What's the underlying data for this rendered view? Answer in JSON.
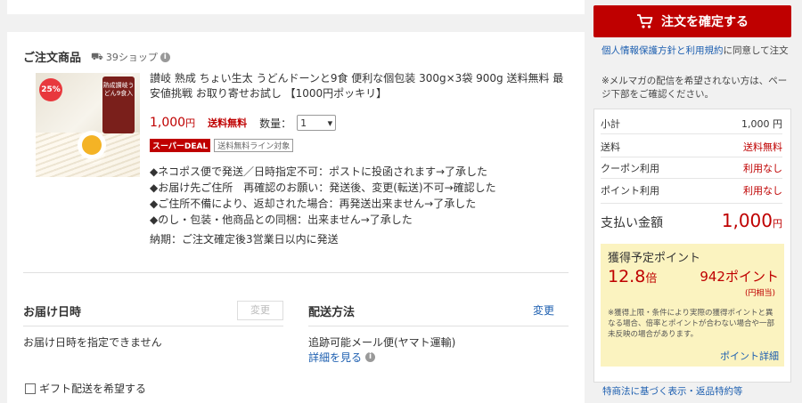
{
  "order": {
    "section_title": "ご注文商品",
    "shop_name": "39ショップ",
    "product_title": "讃岐 熟成 ちょい生太 うどんドーンと9食 便利な個包装 300g×3袋 900g 送料無料 最安値挑戦 お取り寄せお試し 【1000円ポッキリ】",
    "thumb_badge": "25%",
    "thumb_pack_text": "熟成讃岐うどん9食入",
    "price_value": "1,000",
    "price_unit": "円",
    "shipping_free": "送料無料",
    "qty_label": "数量：",
    "qty_value": "1",
    "tag_deal": "スーパーDEAL",
    "tag_free_line": "送料無料ライン対象",
    "notes": [
      "◆ネコポス便で発送／日時指定不可：ポストに投函されます→了承した",
      "◆お届け先ご住所　再確認のお願い：発送後、変更(転送)不可→確認した",
      "◆ご住所不備により、返却された場合：再発送出来ません→了承した",
      "◆のし・包装・他商品との同梱：出来ません→了承した"
    ],
    "delivery_info": "納期：ご注文確定後3営業日以内に発送"
  },
  "delivery": {
    "date_title": "お届け日時",
    "date_change": "変更",
    "date_text": "お届け日時を指定できません",
    "method_title": "配送方法",
    "method_change": "変更",
    "method_text": "追跡可能メール便(ヤマト運輸)",
    "method_detail": "詳細を見る",
    "gift_label": "ギフト配送を希望する"
  },
  "sidebar": {
    "confirm_label": "注文を確定する",
    "privacy_link": "個人情報保護方針と利用規約",
    "privacy_suffix": "に同意して注文",
    "mailmag_note": "※メルマガの配信を希望されない方は、ページ下部をご確認ください。",
    "subtotal_label": "小計",
    "subtotal_value": "1,000 円",
    "shipping_label": "送料",
    "shipping_value": "送料無料",
    "coupon_label": "クーポン利用",
    "coupon_value": "利用なし",
    "point_label": "ポイント利用",
    "point_value": "利用なし",
    "pay_label": "支払い金額",
    "pay_value": "1,000",
    "pay_unit": "円",
    "points_title": "獲得予定ポイント",
    "points_rate": "12.8",
    "points_rate_unit": "倍",
    "points_amount": "942",
    "points_amount_unit": "ポイント",
    "points_sub": "(円相当)",
    "points_fine": "※獲得上限・条件により実際の獲得ポイントと異なる場合、倍率とポイントが合わない場合や一部未反映の場合があります。",
    "points_detail": "ポイント詳細",
    "law_link": "特商法に基づく表示・返品特約等"
  },
  "colors": {
    "accent": "#bf0000",
    "link": "#1d5fb0",
    "points_bg": "#fbf3c0"
  }
}
